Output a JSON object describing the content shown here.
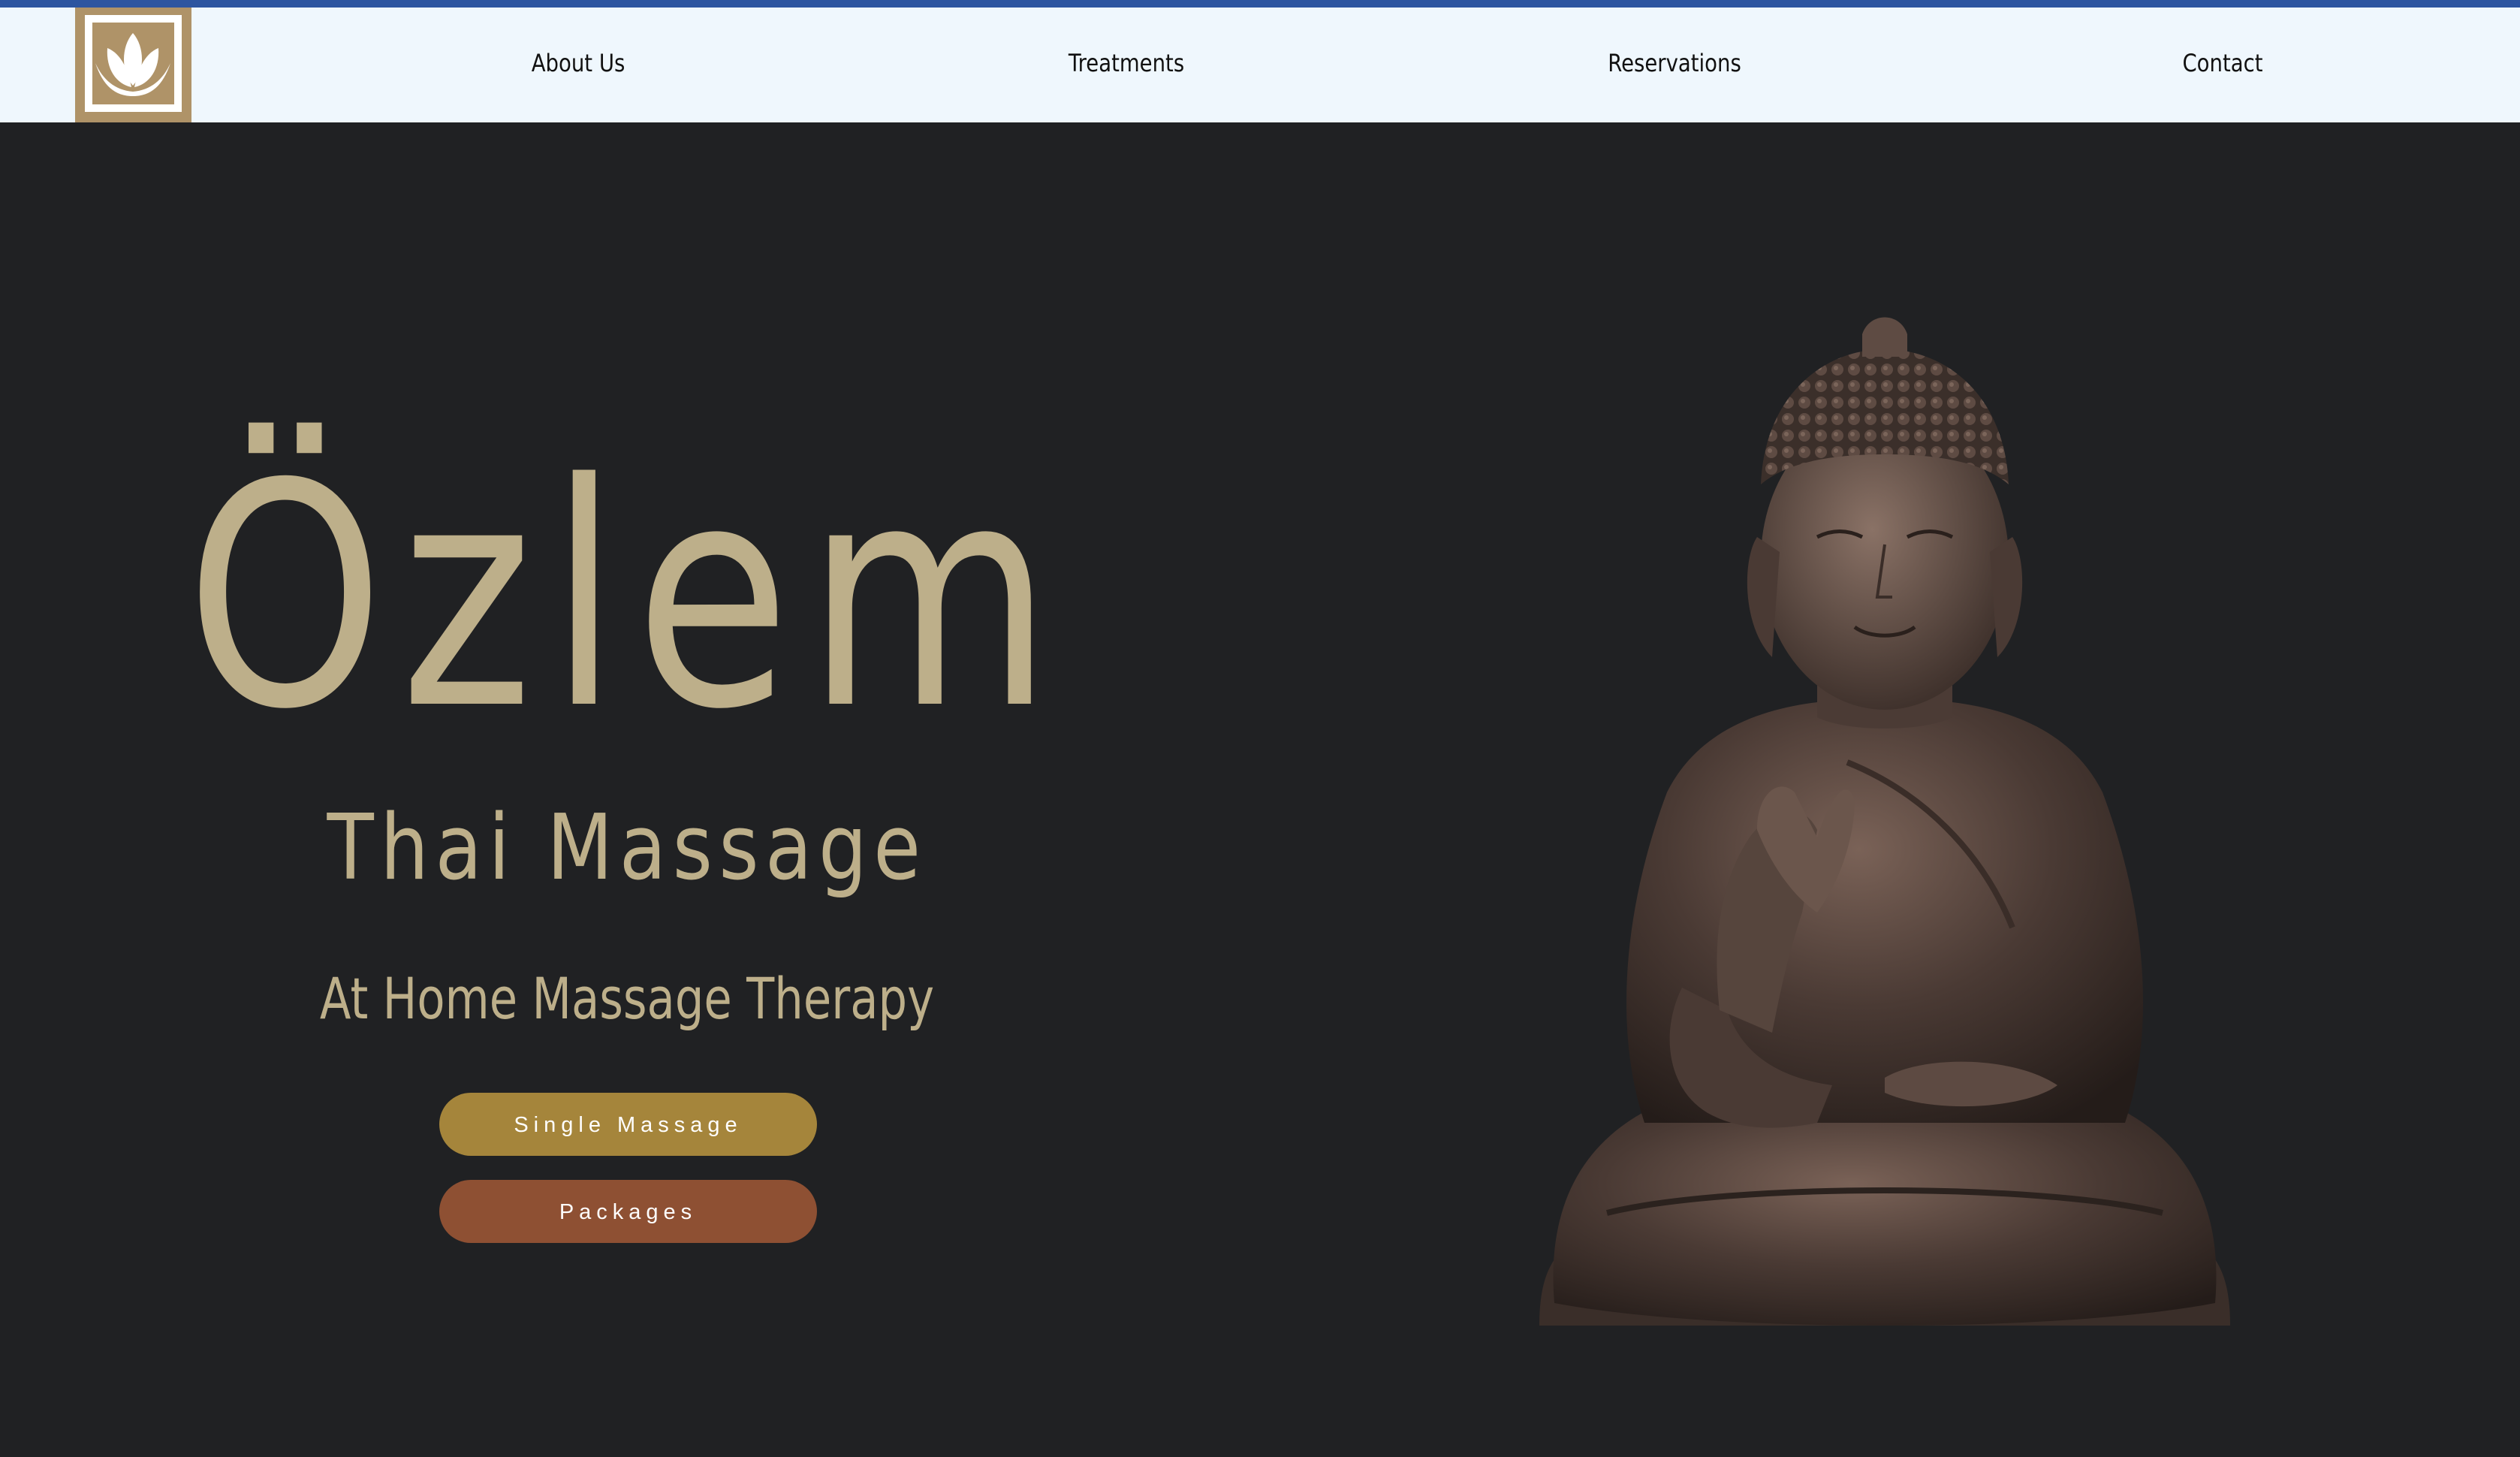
{
  "header": {
    "logo_icon": "lotus-icon",
    "nav": [
      {
        "label": "About Us"
      },
      {
        "label": "Treatments"
      },
      {
        "label": "Reservations"
      },
      {
        "label": "Contact"
      }
    ]
  },
  "hero": {
    "title": "Özlem",
    "subtitle": "Thai Massage",
    "tagline": "At Home Massage Therapy",
    "buttons": {
      "single": "Single Massage",
      "packages": "Packages"
    }
  },
  "colors": {
    "accent_bar": "#2d55a0",
    "nav_background": "#eff7fd",
    "hero_background": "#202123",
    "heading_text": "#bdaf8a",
    "button_single": "#a5853b",
    "button_packages": "#8e5033",
    "logo_brown": "#af9368"
  }
}
